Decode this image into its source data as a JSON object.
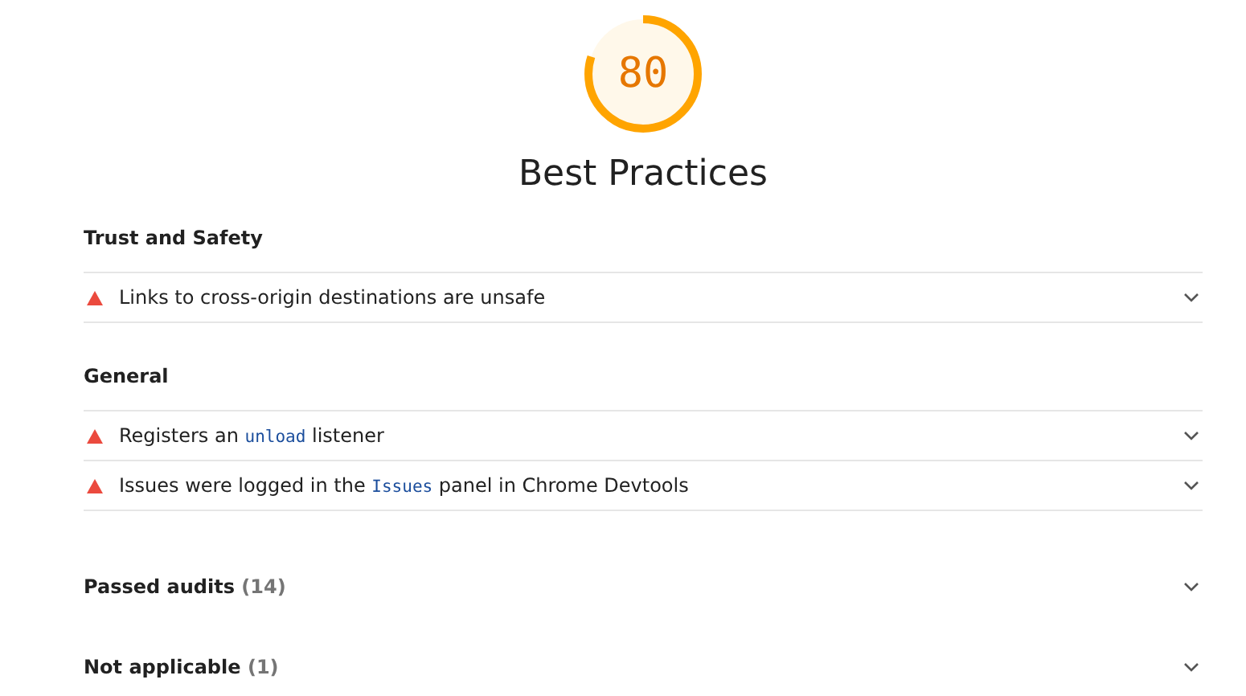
{
  "score": {
    "value": "80",
    "level": 0.8,
    "title": "Best Practices"
  },
  "groups": [
    {
      "title": "Trust and Safety",
      "audits": [
        {
          "parts": [
            {
              "kind": "text",
              "text": "Links to cross-origin destinations are unsafe"
            }
          ]
        }
      ]
    },
    {
      "title": "General",
      "audits": [
        {
          "parts": [
            {
              "kind": "text",
              "text": "Registers an "
            },
            {
              "kind": "code",
              "text": "unload"
            },
            {
              "kind": "text",
              "text": " listener"
            }
          ]
        },
        {
          "parts": [
            {
              "kind": "text",
              "text": "Issues were logged in the "
            },
            {
              "kind": "code",
              "text": "Issues"
            },
            {
              "kind": "text",
              "text": " panel in Chrome Devtools"
            }
          ]
        }
      ]
    }
  ],
  "collapsed": [
    {
      "title": "Passed audits",
      "count": "(14)"
    },
    {
      "title": "Not applicable",
      "count": "(1)"
    }
  ]
}
